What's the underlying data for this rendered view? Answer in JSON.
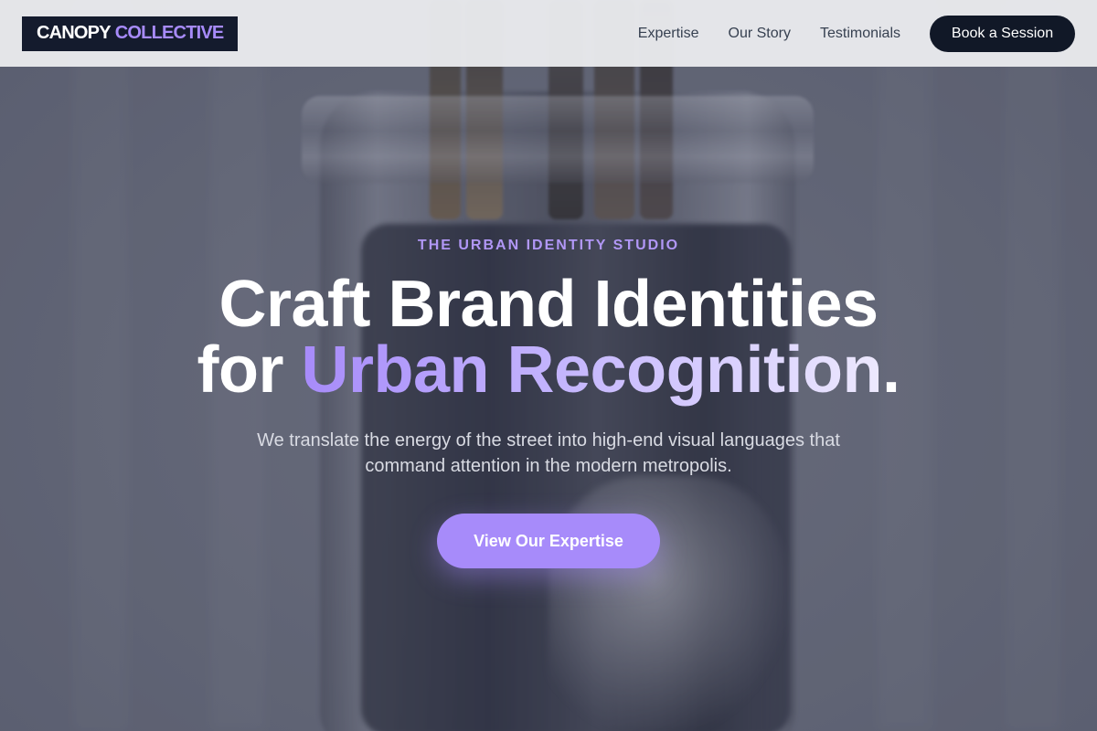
{
  "header": {
    "logo_primary": "CANOPY",
    "logo_accent": "COLLECTIVE",
    "nav_links": [
      "Expertise",
      "Our Story",
      "Testimonials"
    ],
    "cta_label": "Book a Session"
  },
  "hero": {
    "eyebrow": "THE URBAN IDENTITY STUDIO",
    "headline_line1": "Craft Brand Identities",
    "headline_line2_prefix": "for",
    "headline_line2_accent": "Urban Recognition",
    "headline_line2_suffix": ".",
    "subtext": "We translate the energy of the street into high-end visual languages that command attention in the modern metropolis.",
    "cta_label": "View Our Expertise"
  },
  "colors": {
    "accent": "#a78bfa",
    "dark": "#111827",
    "header_bg": "#e8e9ec"
  }
}
